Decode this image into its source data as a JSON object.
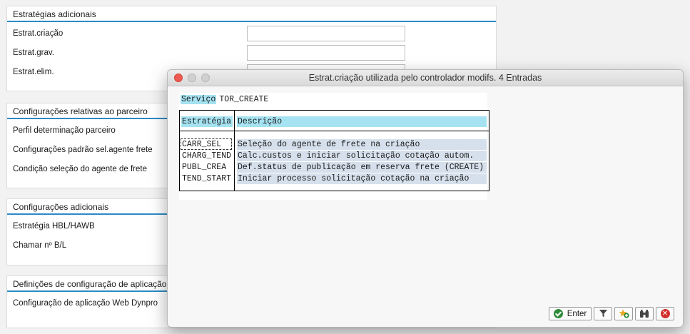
{
  "background": {
    "panels": [
      {
        "title": "Estratégias adicionais",
        "rows": [
          "Estrat.criação",
          "Estrat.grav.",
          "Estrat.elim."
        ]
      },
      {
        "title": "Configurações relativas ao parceiro",
        "rows": [
          "Perfil determinação parceiro",
          "Configurações padrão sel.agente frete",
          "Condição seleção do agente de frete"
        ]
      },
      {
        "title": "Configurações adicionais",
        "rows": [
          "Estratégia HBL/HAWB",
          "Chamar nº B/L"
        ]
      },
      {
        "title": "Definições de configuração de aplicação",
        "rows": [
          "Configuração de aplicação Web Dynpro"
        ]
      }
    ]
  },
  "dialog": {
    "title": "Estrat.criação utilizada pelo controlador modifs. 4 Entradas",
    "service_label": "Serviço",
    "service_value": "TOR_CREATE",
    "columns": [
      "Estratégia",
      "Descrição"
    ],
    "rows": [
      {
        "key": "CARR_SEL",
        "desc": "Seleção do agente de frete na criação"
      },
      {
        "key": "CHARG_TEND",
        "desc": "Calc.custos e iniciar solicitação cotação autom."
      },
      {
        "key": "PUBL_CREA",
        "desc": "Def.status de publicação em reserva frete (CREATE)"
      },
      {
        "key": "TEND_START",
        "desc": "Iniciar processo solicitação cotação na criação"
      }
    ],
    "buttons": {
      "enter_label": "Enter",
      "icons": [
        "filter-icon",
        "add-favorite-icon",
        "find-icon",
        "cancel-icon"
      ]
    }
  },
  "colors": {
    "header_highlight": "#a6e3f2",
    "row_highlight": "#d6e0ec",
    "accent_line": "#2b8ac4"
  }
}
